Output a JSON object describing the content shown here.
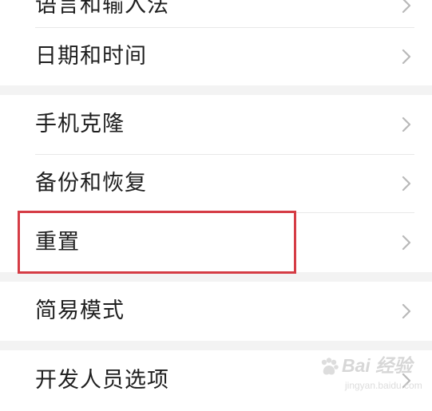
{
  "settings": {
    "items": [
      {
        "label": "语言和输入法"
      },
      {
        "label": "日期和时间"
      },
      {
        "label": "手机克隆"
      },
      {
        "label": "备份和恢复"
      },
      {
        "label": "重置"
      },
      {
        "label": "简易模式"
      },
      {
        "label": "开发人员选项"
      }
    ],
    "highlighted_item": "重置"
  },
  "watermark": {
    "main": "Bai 经验",
    "sub": "jingyan.baidu.com"
  },
  "icons": {
    "chevron": "chevron-right-icon",
    "watermark": "baidu-paw-icon"
  },
  "colors": {
    "highlight_border": "#d53c45",
    "section_gap": "#f3f3f3",
    "text": "#1f1f1f",
    "chevron": "#b8b8b8"
  }
}
